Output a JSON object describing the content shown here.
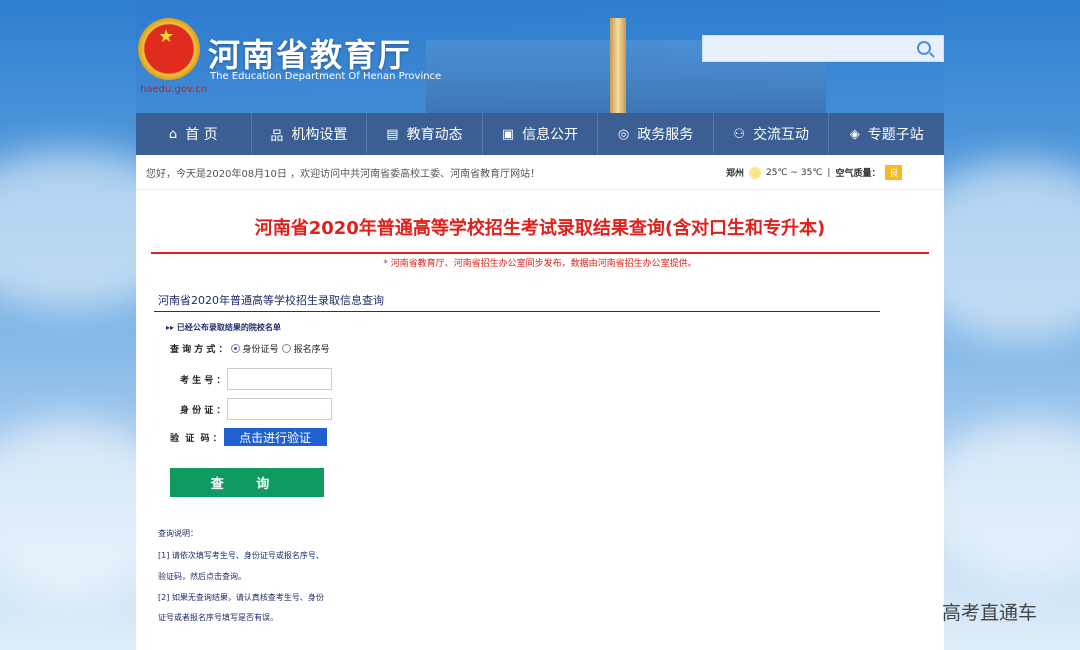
{
  "header": {
    "title": "河南省教育厅",
    "subtitle": "The Education Department Of Henan Province",
    "domain": "haedu.gov.cn",
    "search_placeholder": ""
  },
  "nav": [
    {
      "icon": "⌂",
      "label": "首 页"
    },
    {
      "icon": "品",
      "label": "机构设置"
    },
    {
      "icon": "▤",
      "label": "教育动态"
    },
    {
      "icon": "▣",
      "label": "信息公开"
    },
    {
      "icon": "◎",
      "label": "政务服务"
    },
    {
      "icon": "⚇",
      "label": "交流互动"
    },
    {
      "icon": "◈",
      "label": "专题子站"
    }
  ],
  "welcome": {
    "text": "您好，今天是2020年08月10日 ，欢迎访问中共河南省委高校工委、河南省教育厅网站！",
    "city": "郑州",
    "temp": "25℃ ~ 35℃",
    "sep": "|",
    "aq_label": "空气质量：",
    "aq_value": "良"
  },
  "main": {
    "title": "河南省2020年普通高等学校招生考试录取结果查询(含对口生和专升本)",
    "notice": "* 河南省教育厅、河南省招生办公室同步发布，数据由河南省招生办公室提供。",
    "section_title": "河南省2020年普通高等学校招生录取信息查询",
    "schools_link": "▸▸ 已经公布录取结果的院校名单",
    "query_mode_label": "查 询 方 式 ：",
    "mode_options": [
      "身份证号",
      "报名序号"
    ],
    "exam_no_label": "考 生 号 ：",
    "id_label": "身 份 证 ：",
    "captcha_label": "验  证  码 ：",
    "verify_button": "点击进行验证",
    "submit": "查 询",
    "help": [
      "查询说明：",
      "[1] 请依次填写考生号、身份证号或报名序号、",
      "验证码，然后点击查询。",
      "[2] 如果无查询结果，请认真核查考生号、身份",
      "证号或者报名序号填写是否有误。"
    ]
  },
  "watermark": "高考直通车"
}
